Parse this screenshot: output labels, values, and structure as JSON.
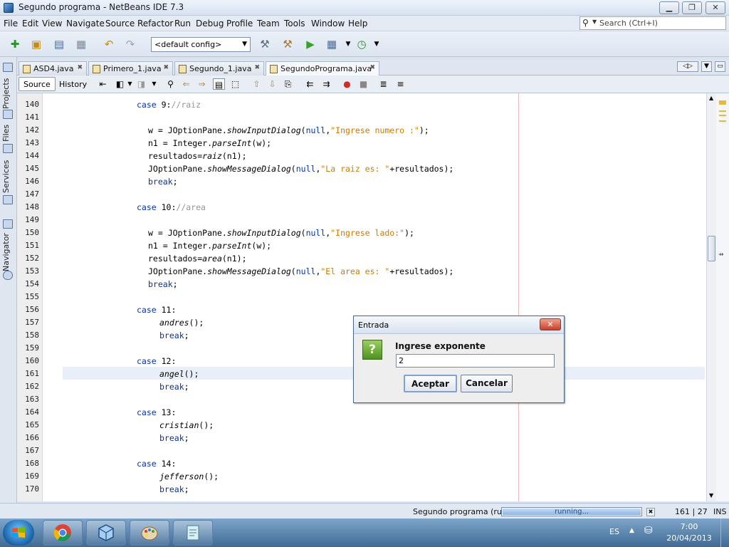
{
  "window": {
    "title": "Segundo programa - NetBeans IDE 7.3",
    "controls": {
      "minimize": "▁",
      "maximize": "❐",
      "close": "✕"
    }
  },
  "menu": [
    "File",
    "Edit",
    "View",
    "Navigate",
    "Source",
    "Refactor",
    "Run",
    "Debug",
    "Profile",
    "Team",
    "Tools",
    "Window",
    "Help"
  ],
  "search": {
    "placeholder": "Search (Ctrl+I)"
  },
  "toolbar": {
    "config": "<default config>"
  },
  "side_tabs": [
    "Projects",
    "Files",
    "Services",
    "Navigator"
  ],
  "tabs": [
    {
      "label": "ASD4.java"
    },
    {
      "label": "Primero_1.java"
    },
    {
      "label": "Segundo_1.java"
    },
    {
      "label": "SegundoPrograma.java",
      "active": true
    }
  ],
  "editor_toolbar": {
    "source": "Source",
    "history": "History"
  },
  "code": {
    "highlight_line": "161",
    "lines": [
      {
        "n": "140",
        "indent": 14,
        "parts": [
          {
            "t": "case ",
            "c": "kw"
          },
          {
            "t": "9:"
          },
          {
            "t": "//raiz",
            "c": "cm"
          }
        ]
      },
      {
        "n": "141",
        "indent": 0,
        "parts": []
      },
      {
        "n": "142",
        "indent": 16,
        "parts": [
          {
            "t": "w = JOptionPane."
          },
          {
            "t": "showInputDialog",
            "c": "it"
          },
          {
            "t": "("
          },
          {
            "t": "null",
            "c": "kw"
          },
          {
            "t": ","
          },
          {
            "t": "\"Ingrese numero :\"",
            "c": "str"
          },
          {
            "t": ");"
          }
        ]
      },
      {
        "n": "143",
        "indent": 16,
        "parts": [
          {
            "t": "n1 = Integer."
          },
          {
            "t": "parseInt",
            "c": "it"
          },
          {
            "t": "(w);"
          }
        ]
      },
      {
        "n": "144",
        "indent": 16,
        "parts": [
          {
            "t": "resultados="
          },
          {
            "t": "raiz",
            "c": "it"
          },
          {
            "t": "(n1);"
          }
        ]
      },
      {
        "n": "145",
        "indent": 16,
        "parts": [
          {
            "t": "JOptionPane."
          },
          {
            "t": "showMessageDialog",
            "c": "it"
          },
          {
            "t": "("
          },
          {
            "t": "null",
            "c": "kw"
          },
          {
            "t": ","
          },
          {
            "t": "\"La raiz es: \"",
            "c": "str"
          },
          {
            "t": "+resultados);"
          }
        ]
      },
      {
        "n": "146",
        "indent": 16,
        "parts": [
          {
            "t": "break",
            "c": "kw"
          },
          {
            "t": ";"
          }
        ]
      },
      {
        "n": "147",
        "indent": 0,
        "parts": []
      },
      {
        "n": "148",
        "indent": 14,
        "parts": [
          {
            "t": "case ",
            "c": "kw"
          },
          {
            "t": "10:"
          },
          {
            "t": "//area",
            "c": "cm"
          }
        ]
      },
      {
        "n": "149",
        "indent": 0,
        "parts": []
      },
      {
        "n": "150",
        "indent": 16,
        "parts": [
          {
            "t": "w = JOptionPane."
          },
          {
            "t": "showInputDialog",
            "c": "it"
          },
          {
            "t": "("
          },
          {
            "t": "null",
            "c": "kw"
          },
          {
            "t": ","
          },
          {
            "t": "\"Ingrese lado:\"",
            "c": "str"
          },
          {
            "t": ");"
          }
        ]
      },
      {
        "n": "151",
        "indent": 16,
        "parts": [
          {
            "t": "n1 = Integer."
          },
          {
            "t": "parseInt",
            "c": "it"
          },
          {
            "t": "(w);"
          }
        ]
      },
      {
        "n": "152",
        "indent": 16,
        "parts": [
          {
            "t": "resultados="
          },
          {
            "t": "area",
            "c": "it"
          },
          {
            "t": "(n1);"
          }
        ]
      },
      {
        "n": "153",
        "indent": 16,
        "parts": [
          {
            "t": "JOptionPane."
          },
          {
            "t": "showMessageDialog",
            "c": "it"
          },
          {
            "t": "("
          },
          {
            "t": "null",
            "c": "kw"
          },
          {
            "t": ","
          },
          {
            "t": "\"El area es: \"",
            "c": "str"
          },
          {
            "t": "+resultados);"
          }
        ]
      },
      {
        "n": "154",
        "indent": 16,
        "parts": [
          {
            "t": "break",
            "c": "kw"
          },
          {
            "t": ";"
          }
        ]
      },
      {
        "n": "155",
        "indent": 0,
        "parts": []
      },
      {
        "n": "156",
        "indent": 14,
        "parts": [
          {
            "t": "case ",
            "c": "kw"
          },
          {
            "t": "11:"
          }
        ]
      },
      {
        "n": "157",
        "indent": 18,
        "parts": [
          {
            "t": "andres",
            "c": "it"
          },
          {
            "t": "();"
          }
        ]
      },
      {
        "n": "158",
        "indent": 18,
        "parts": [
          {
            "t": "break",
            "c": "kw"
          },
          {
            "t": ";"
          }
        ]
      },
      {
        "n": "159",
        "indent": 0,
        "parts": []
      },
      {
        "n": "160",
        "indent": 14,
        "parts": [
          {
            "t": "case ",
            "c": "kw"
          },
          {
            "t": "12:"
          }
        ]
      },
      {
        "n": "161",
        "indent": 18,
        "parts": [
          {
            "t": "angel",
            "c": "it"
          },
          {
            "t": "();"
          }
        ]
      },
      {
        "n": "162",
        "indent": 18,
        "parts": [
          {
            "t": "break",
            "c": "kw"
          },
          {
            "t": ";"
          }
        ]
      },
      {
        "n": "163",
        "indent": 0,
        "parts": []
      },
      {
        "n": "164",
        "indent": 14,
        "parts": [
          {
            "t": "case ",
            "c": "kw"
          },
          {
            "t": "13:"
          }
        ]
      },
      {
        "n": "165",
        "indent": 18,
        "parts": [
          {
            "t": "cristian",
            "c": "it"
          },
          {
            "t": "();"
          }
        ]
      },
      {
        "n": "166",
        "indent": 18,
        "parts": [
          {
            "t": "break",
            "c": "kw"
          },
          {
            "t": ";"
          }
        ]
      },
      {
        "n": "167",
        "indent": 0,
        "parts": []
      },
      {
        "n": "168",
        "indent": 14,
        "parts": [
          {
            "t": "case ",
            "c": "kw"
          },
          {
            "t": "14:"
          }
        ]
      },
      {
        "n": "169",
        "indent": 18,
        "parts": [
          {
            "t": "jefferson",
            "c": "it"
          },
          {
            "t": "();"
          }
        ]
      },
      {
        "n": "170",
        "indent": 18,
        "parts": [
          {
            "t": "break",
            "c": "kw"
          },
          {
            "t": ";"
          }
        ]
      }
    ]
  },
  "status": {
    "task": "Segundo programa (run)",
    "progress_text": "running...",
    "position": "161 | 27",
    "mode": "INS"
  },
  "dialog": {
    "title": "Entrada",
    "prompt": "Ingrese exponente",
    "value": "2",
    "ok": "Aceptar",
    "cancel": "Cancelar",
    "icon": "?"
  },
  "taskbar": {
    "lang": "ES",
    "time": "7:00",
    "date": "20/04/2013"
  },
  "colors": {
    "keyword": "#0033b3",
    "string": "#ce7b00",
    "comment": "#969696"
  }
}
